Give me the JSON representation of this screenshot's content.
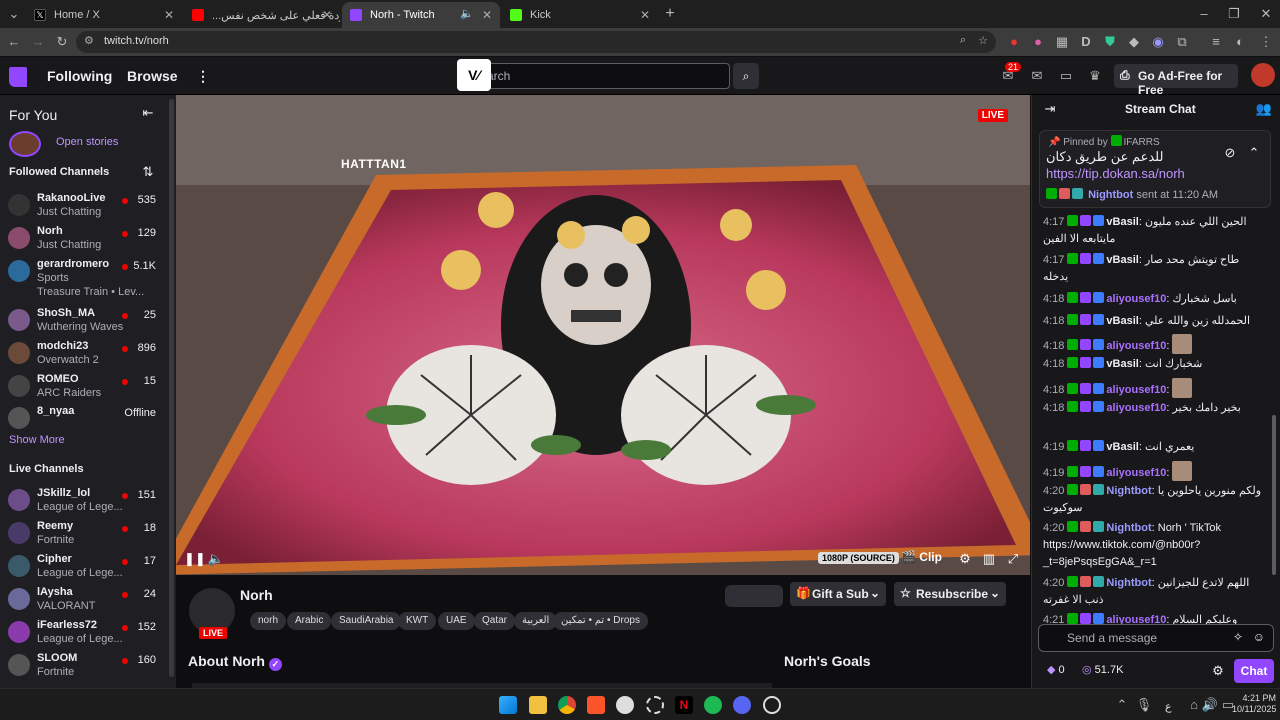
{
  "browser": {
    "tabs": [
      {
        "title": "Home / X",
        "icon": "x-icon"
      },
      {
        "title": "(665) ردة فعلي على شخص نفس...",
        "icon": "youtube-icon"
      },
      {
        "title": "Norh - Twitch",
        "icon": "twitch-icon"
      },
      {
        "title": "Kick",
        "icon": "kick-icon"
      }
    ],
    "url": "twitch.tv/norh"
  },
  "topnav": {
    "following": "Following",
    "browse": "Browse",
    "search_placeholder": "Search",
    "search_visible": "arch",
    "logo_text": "V",
    "notif_count": "21",
    "adfree": "Go Ad-Free for Free"
  },
  "sidebar": {
    "for_you": "For You",
    "open_stories": "Open stories",
    "followed_title": "Followed Channels",
    "followed": [
      {
        "name": "RakanooLive",
        "game": "Just Chatting",
        "viewers": "535",
        "live": true
      },
      {
        "name": "Norh",
        "game": "Just Chatting",
        "viewers": "129",
        "live": true
      },
      {
        "name": "gerardromero",
        "game": "Sports",
        "extra": "Treasure Train • Lev...",
        "viewers": "5.1K",
        "live": true
      },
      {
        "name": "ShoSh_MA",
        "game": "Wuthering Waves",
        "viewers": "25",
        "live": true
      },
      {
        "name": "modchi23",
        "game": "Overwatch 2",
        "viewers": "896",
        "live": true
      },
      {
        "name": "ROMEO",
        "game": "ARC Raiders",
        "viewers": "15",
        "live": true
      },
      {
        "name": "8_nyaa",
        "game": "",
        "viewers": "Offline",
        "live": false
      }
    ],
    "show_more": "Show More",
    "live_title": "Live Channels",
    "live": [
      {
        "name": "JSkillz_lol",
        "game": "League of Lege...",
        "viewers": "151"
      },
      {
        "name": "Reemy",
        "game": "Fortnite",
        "viewers": "18"
      },
      {
        "name": "Cipher",
        "game": "League of Lege...",
        "viewers": "17"
      },
      {
        "name": "lAysha",
        "game": "VALORANT",
        "viewers": "24"
      },
      {
        "name": "iFearless72",
        "game": "League of Lege...",
        "viewers": "152"
      },
      {
        "name": "SLOOM",
        "game": "Fortnite",
        "viewers": "160"
      }
    ]
  },
  "video": {
    "live_badge": "LIVE",
    "watermark": "HATTTAN1",
    "quality": "1080P (SOURCE)",
    "clip": "Clip"
  },
  "channel": {
    "name": "Norh",
    "live_badge": "LIVE",
    "tags": [
      "norh",
      "Arabic",
      "SaudiArabia",
      "KWT",
      "UAE",
      "Qatar",
      "العربية",
      "تم • تمكين • Drops"
    ],
    "gift_sub": "Gift a Sub",
    "resubscribe": "Resubscribe",
    "about": "About Norh",
    "goals": "Norh's Goals"
  },
  "chat": {
    "title": "Stream Chat",
    "pinned_by_label": "Pinned by",
    "pinned_by": "IFARRS",
    "pinned_text": "للدعم عن طريق دكان",
    "pinned_link": "https://tip.dokan.sa/norh",
    "pinned_user": "Nightbot",
    "pinned_sent": "sent at 11:20 AM",
    "messages": [
      {
        "time": "4:17",
        "user": "vBasil",
        "color": "#efeff1",
        "text": "الحين اللي عنده مليون مايتابعه الا الفين"
      },
      {
        "time": "4:17",
        "user": "vBasil",
        "color": "#efeff1",
        "text": "طاح تويتش محد صار يدخله"
      },
      {
        "time": "4:18",
        "user": "aliyousef10",
        "color": "#a970ff",
        "text": "باسل شخبارك"
      },
      {
        "time": "4:18",
        "user": "vBasil",
        "color": "#efeff1",
        "text": "الحمدلله زين والله علي"
      },
      {
        "time": "4:18",
        "user": "aliyousef10",
        "color": "#a970ff",
        "text": ""
      },
      {
        "time": "4:18",
        "user": "vBasil",
        "color": "#efeff1",
        "text": "شخبارك انت"
      },
      {
        "time": "4:18",
        "user": "aliyousef10",
        "color": "#a970ff",
        "text": ""
      },
      {
        "time": "4:18",
        "user": "aliyousef10",
        "color": "#a970ff",
        "text": "بخير دامك بخير"
      },
      {
        "time": "4:19",
        "user": "vBasil",
        "color": "#efeff1",
        "text": "يعمري انت"
      },
      {
        "time": "4:19",
        "user": "aliyousef10",
        "color": "#a970ff",
        "text": ""
      },
      {
        "time": "4:20",
        "user": "Nightbot",
        "color": "#9b9bff",
        "text": "ولكم منورين ياحلوين يا سوكيوت"
      },
      {
        "time": "4:20",
        "user": "Nightbot",
        "color": "#9b9bff",
        "text": "Norh ' TikTok https://www.tiktok.com/@nb00r?_t=8jePsqsEgGA&_r=1"
      },
      {
        "time": "4:20",
        "user": "Nightbot",
        "color": "#9b9bff",
        "text": "اللهم لاتدع للجيزانين ذنب الا غفرته"
      },
      {
        "time": "4:21",
        "user": "aliyousef10",
        "color": "#a970ff",
        "text": "وعليكم السلام"
      }
    ],
    "send_placeholder": "Send a message",
    "bits": "0",
    "points": "51.7K",
    "chat_button": "Chat"
  },
  "taskbar": {
    "lang": "ع",
    "time": "4:21 PM",
    "date": "10/11/2025"
  },
  "colors": {
    "twitch_purple": "#9146ff",
    "live_red": "#eb0400"
  }
}
